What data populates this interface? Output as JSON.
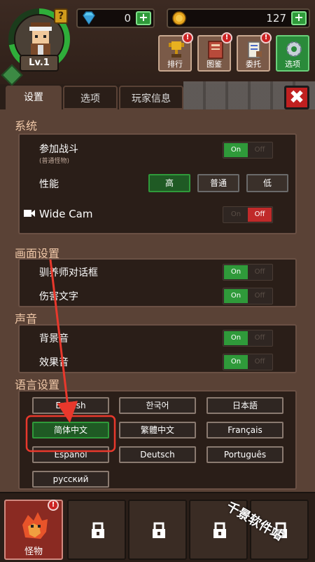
{
  "hud": {
    "level": "Lv.1",
    "help": "?",
    "gems": "0",
    "gold": "127",
    "plus": "+",
    "buttons": [
      {
        "label": "排行",
        "icon": "trophy-icon",
        "alert": true
      },
      {
        "label": "图鉴",
        "icon": "book-icon",
        "alert": true
      },
      {
        "label": "委托",
        "icon": "scroll-icon",
        "alert": true
      },
      {
        "label": "选项",
        "icon": "gear-icon",
        "alert": false
      }
    ],
    "alert_mark": "!"
  },
  "tabs": [
    "设置",
    "选项",
    "玩家信息"
  ],
  "close": "✖",
  "system": {
    "title": "系统",
    "join_battle": "参加战斗",
    "join_battle_sub": "(普通怪物)",
    "join_battle_state": "On",
    "performance": "性能",
    "perf_options": [
      "高",
      "普通",
      "低"
    ],
    "perf_selected": "高",
    "wide_cam": "Wide Cam",
    "wide_cam_state": "Off"
  },
  "display": {
    "title": "画面设置",
    "trainer_dialog": "驯养师对话框",
    "trainer_dialog_state": "On",
    "damage_text": "伤害文字",
    "damage_text_state": "On"
  },
  "sound": {
    "title": "声音",
    "bgm": "背景音",
    "bgm_state": "On",
    "sfx": "效果音",
    "sfx_state": "On"
  },
  "toggle_labels": {
    "on": "On",
    "off": "Off"
  },
  "language": {
    "title": "语言设置",
    "options": [
      "English",
      "한국어",
      "日本語",
      "简体中文",
      "繁體中文",
      "Français",
      "Español",
      "Deutsch",
      "Português",
      "русский"
    ],
    "selected": "简体中文"
  },
  "bottom": {
    "slots": [
      {
        "label": "怪物",
        "locked": false,
        "alert": true
      },
      {
        "label": "",
        "locked": true
      },
      {
        "label": "",
        "locked": true
      },
      {
        "label": "",
        "locked": true
      },
      {
        "label": "",
        "locked": true
      }
    ]
  },
  "watermark": "千景软件站",
  "colors": {
    "accent_green": "#2f9a3a",
    "off_red": "#c02a2a",
    "panel": "#5a4236",
    "annotation": "#e8382c"
  }
}
